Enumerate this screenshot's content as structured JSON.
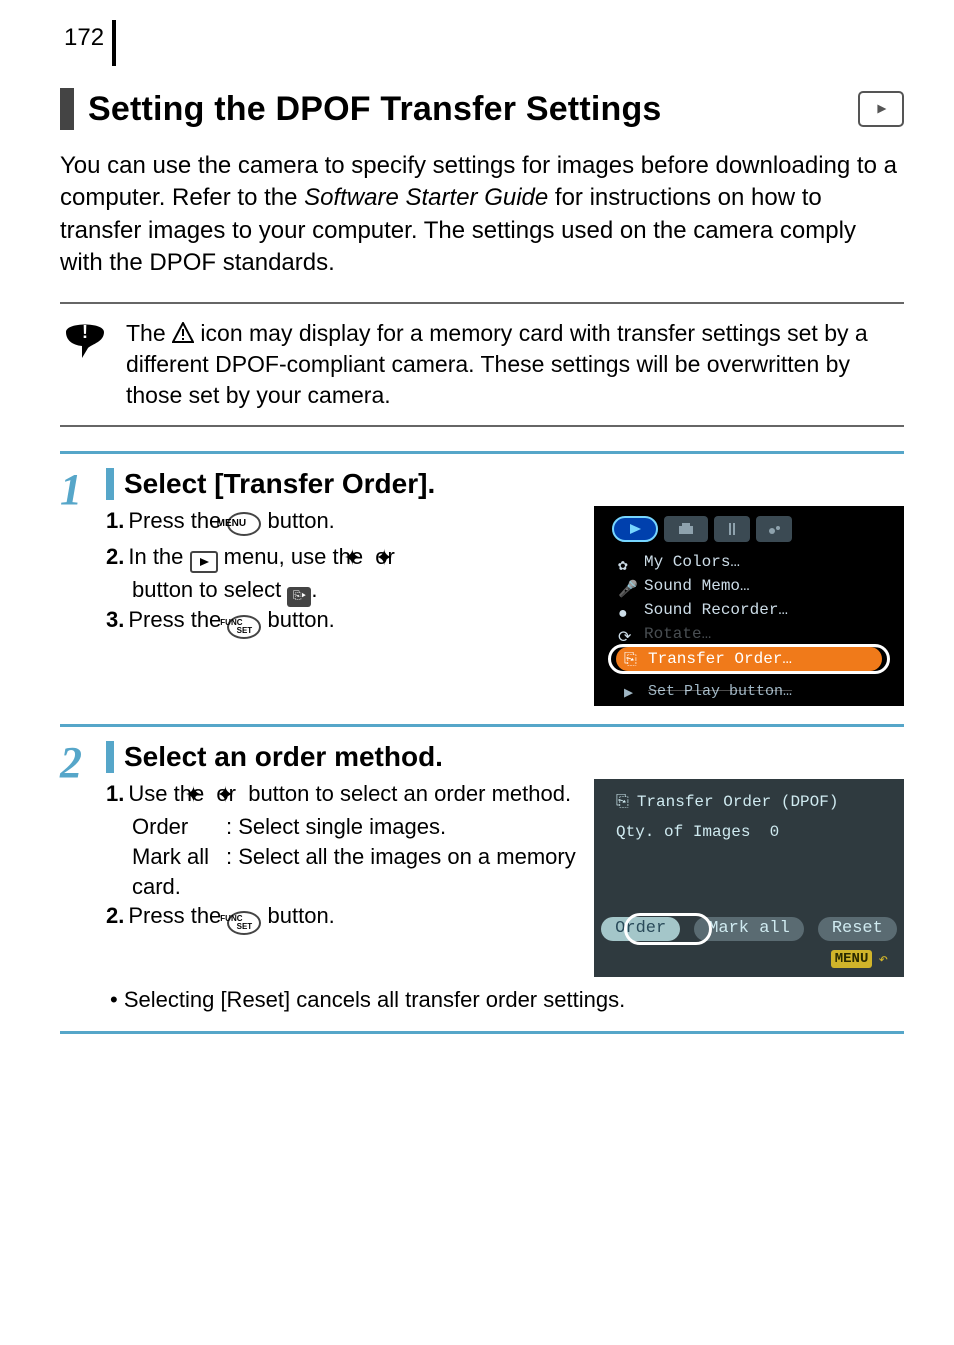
{
  "page_number": "172",
  "heading": "Setting the DPOF Transfer Settings",
  "intro": {
    "part1": "You can use the camera to specify settings for images before downloading to a computer. Refer to the ",
    "italic": "Software Starter Guide",
    "part2": " for instructions on how to transfer images to your computer. The settings used on the camera comply with the DPOF standards."
  },
  "note": {
    "before_icon": "The ",
    "after_icon": " icon may display for a memory card with transfer settings set by a different DPOF-compliant camera. These settings will be overwritten by those set by your camera."
  },
  "steps": [
    {
      "number": "1",
      "title": "Select [Transfer Order].",
      "lines": [
        {
          "n": "1.",
          "before": "Press the ",
          "btn": "MENU",
          "after": " button."
        },
        {
          "n": "2.",
          "before": "In the ",
          "icon": "play",
          "mid": " menu, use the ",
          "arrows": "updown",
          "after2": "button to select ",
          "icon2": "xfer",
          "end": "."
        },
        {
          "n": "3.",
          "before": "Press the ",
          "btn": "FUNC SET",
          "after": " button."
        }
      ],
      "lcd_menu": {
        "items": [
          "My Colors…",
          "Sound Memo…",
          "Sound Recorder…",
          "Rotate…"
        ],
        "highlight": "Transfer Order…",
        "footer": "Set Play button…"
      }
    },
    {
      "number": "2",
      "title": "Select an order method.",
      "lines": [
        {
          "n": "1.",
          "before": "Use the ",
          "arrows": "leftright",
          "after": " button to select an order method."
        }
      ],
      "defs": [
        {
          "label": "Order",
          "desc": ": Select single images."
        },
        {
          "label": "Mark all",
          "desc": ": Select all the images on a memory card."
        }
      ],
      "line2": {
        "n": "2.",
        "before": "Press the ",
        "btn": "FUNC SET",
        "after": " button."
      },
      "bullet": "Selecting [Reset] cancels all transfer order settings.",
      "lcd2": {
        "title": "Transfer Order (DPOF)",
        "qty_label": "Qty. of Images",
        "qty_value": "0",
        "buttons": [
          "Order",
          "Mark all",
          "Reset"
        ],
        "menu_label": "MENU"
      }
    }
  ]
}
